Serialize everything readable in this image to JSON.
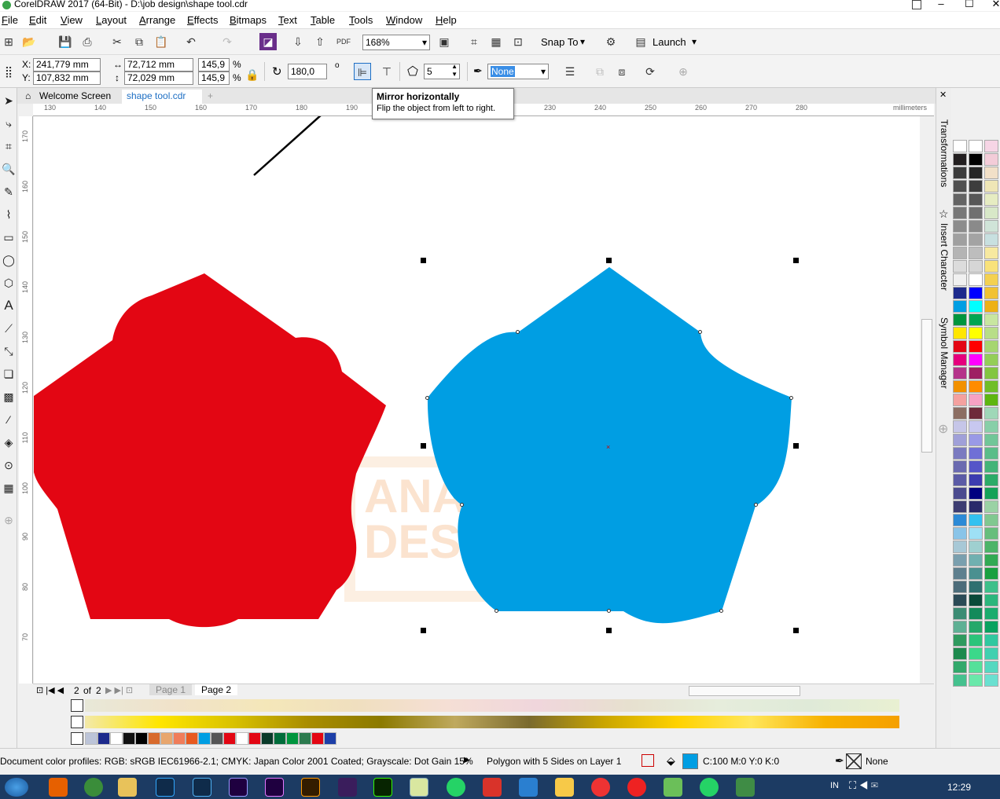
{
  "window": {
    "title": "CorelDRAW 2017 (64-Bit) - D:\\job design\\shape tool.cdr"
  },
  "menu": [
    "File",
    "Edit",
    "View",
    "Layout",
    "Arrange",
    "Effects",
    "Bitmaps",
    "Text",
    "Table",
    "Tools",
    "Window",
    "Help"
  ],
  "standard_bar": {
    "zoom": "168%",
    "snap_to": "Snap To",
    "launch": "Launch"
  },
  "property_bar": {
    "x": "241,779 mm",
    "y": "107,832 mm",
    "x_label": "X:",
    "y_label": "Y:",
    "width": "72,712 mm",
    "height": "72,029 mm",
    "scale_w": "145,9",
    "scale_h": "145,9",
    "percent": "%",
    "rotation": "180,0",
    "degree": "o",
    "sides": "5",
    "outline": "None"
  },
  "tabs": {
    "welcome": "Welcome Screen",
    "doc": "shape tool.cdr",
    "add": "+"
  },
  "ruler": {
    "h_ticks": [
      "130",
      "140",
      "150",
      "160",
      "170",
      "180",
      "190",
      "230",
      "240",
      "250",
      "260",
      "270",
      "280"
    ],
    "v_ticks": [
      "170",
      "160",
      "150",
      "140",
      "130",
      "120",
      "110",
      "100",
      "90",
      "80",
      "70"
    ],
    "units": "millimeters"
  },
  "tooltip": {
    "title": "Mirror horizontally",
    "desc": "Flip the object from left to right."
  },
  "watermark": {
    "line1": "ANAK",
    "line2": "DESG"
  },
  "page_nav": {
    "current": "2",
    "of": "of",
    "total": "2",
    "page1": "Page 1",
    "page2": "Page 2"
  },
  "dockers": {
    "transformations": "Transformations",
    "insert_character": "Insert Character",
    "symbol_manager": "Symbol Manager"
  },
  "status": {
    "profiles": "Document color profiles: RGB: sRGB IEC61966-2.1; CMYK: Japan Color 2001 Coated; Grayscale: Dot Gain 15%",
    "object": "Polygon with 5 Sides on Layer 1",
    "fill": "C:100 M:0 Y:0 K:0",
    "outline": "None"
  },
  "taskbar": {
    "lang": "IN",
    "time": "12:29"
  },
  "colors": {
    "red_shape": "#e30613",
    "blue_shape": "#009ee3",
    "accent": "#1e6fc4"
  }
}
